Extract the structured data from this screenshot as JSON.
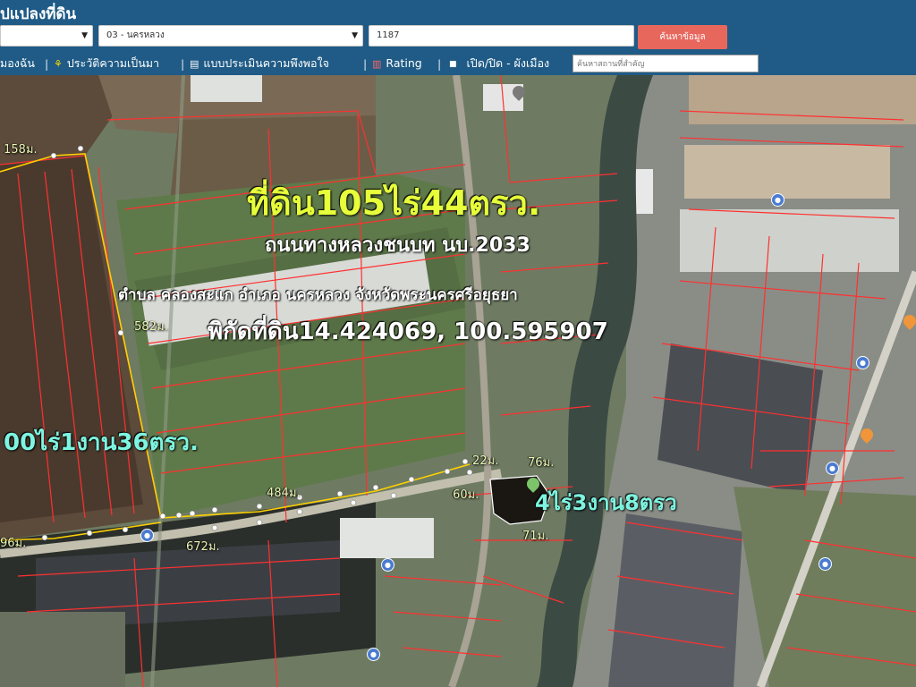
{
  "header": {
    "title": "ปแปลงที่ดิน",
    "province_select_value": "",
    "district_select_value": "03 - นครหลวง",
    "deed_input_value": "1187",
    "search_button": "ค้นหาข้อมูล"
  },
  "toolbar": {
    "items": [
      "มองฉัน",
      "ประวัติความเป็นมา",
      "แบบประเมินความพึงพอใจ",
      "Rating",
      "เปิด/ปิด - ผังเมือง"
    ],
    "poi_placeholder": "ค้นหาสถานที่สำคัญ"
  },
  "map": {
    "headline": "ที่ดิน105ไร่44ตรว.",
    "road": "ถนนทางหลวงชนบท นบ.2033",
    "location": "ตำบล คลองสะแก อำเภอ นครหลวง จังหวัดพระนครศรีอยุธยา",
    "coordinates": "พิกัดที่ดิน14.424069, 100.595907",
    "left_plot_area": "00ไร่1งาน36ตรว.",
    "right_plot_area": "4ไร่3งาน8ตรว",
    "dimensions": [
      "158ม.",
      "582ม.",
      "484ม.",
      "672ม.",
      "96ม.",
      "22ม.",
      "76ม.",
      "60ม.",
      "71ม."
    ],
    "colors": {
      "boundary": "#ff3030",
      "highlight": "#ffd000",
      "headline_fill": "#e6ff3a",
      "white_text": "#ffffff",
      "cyan_text": "#7df5e0"
    }
  }
}
